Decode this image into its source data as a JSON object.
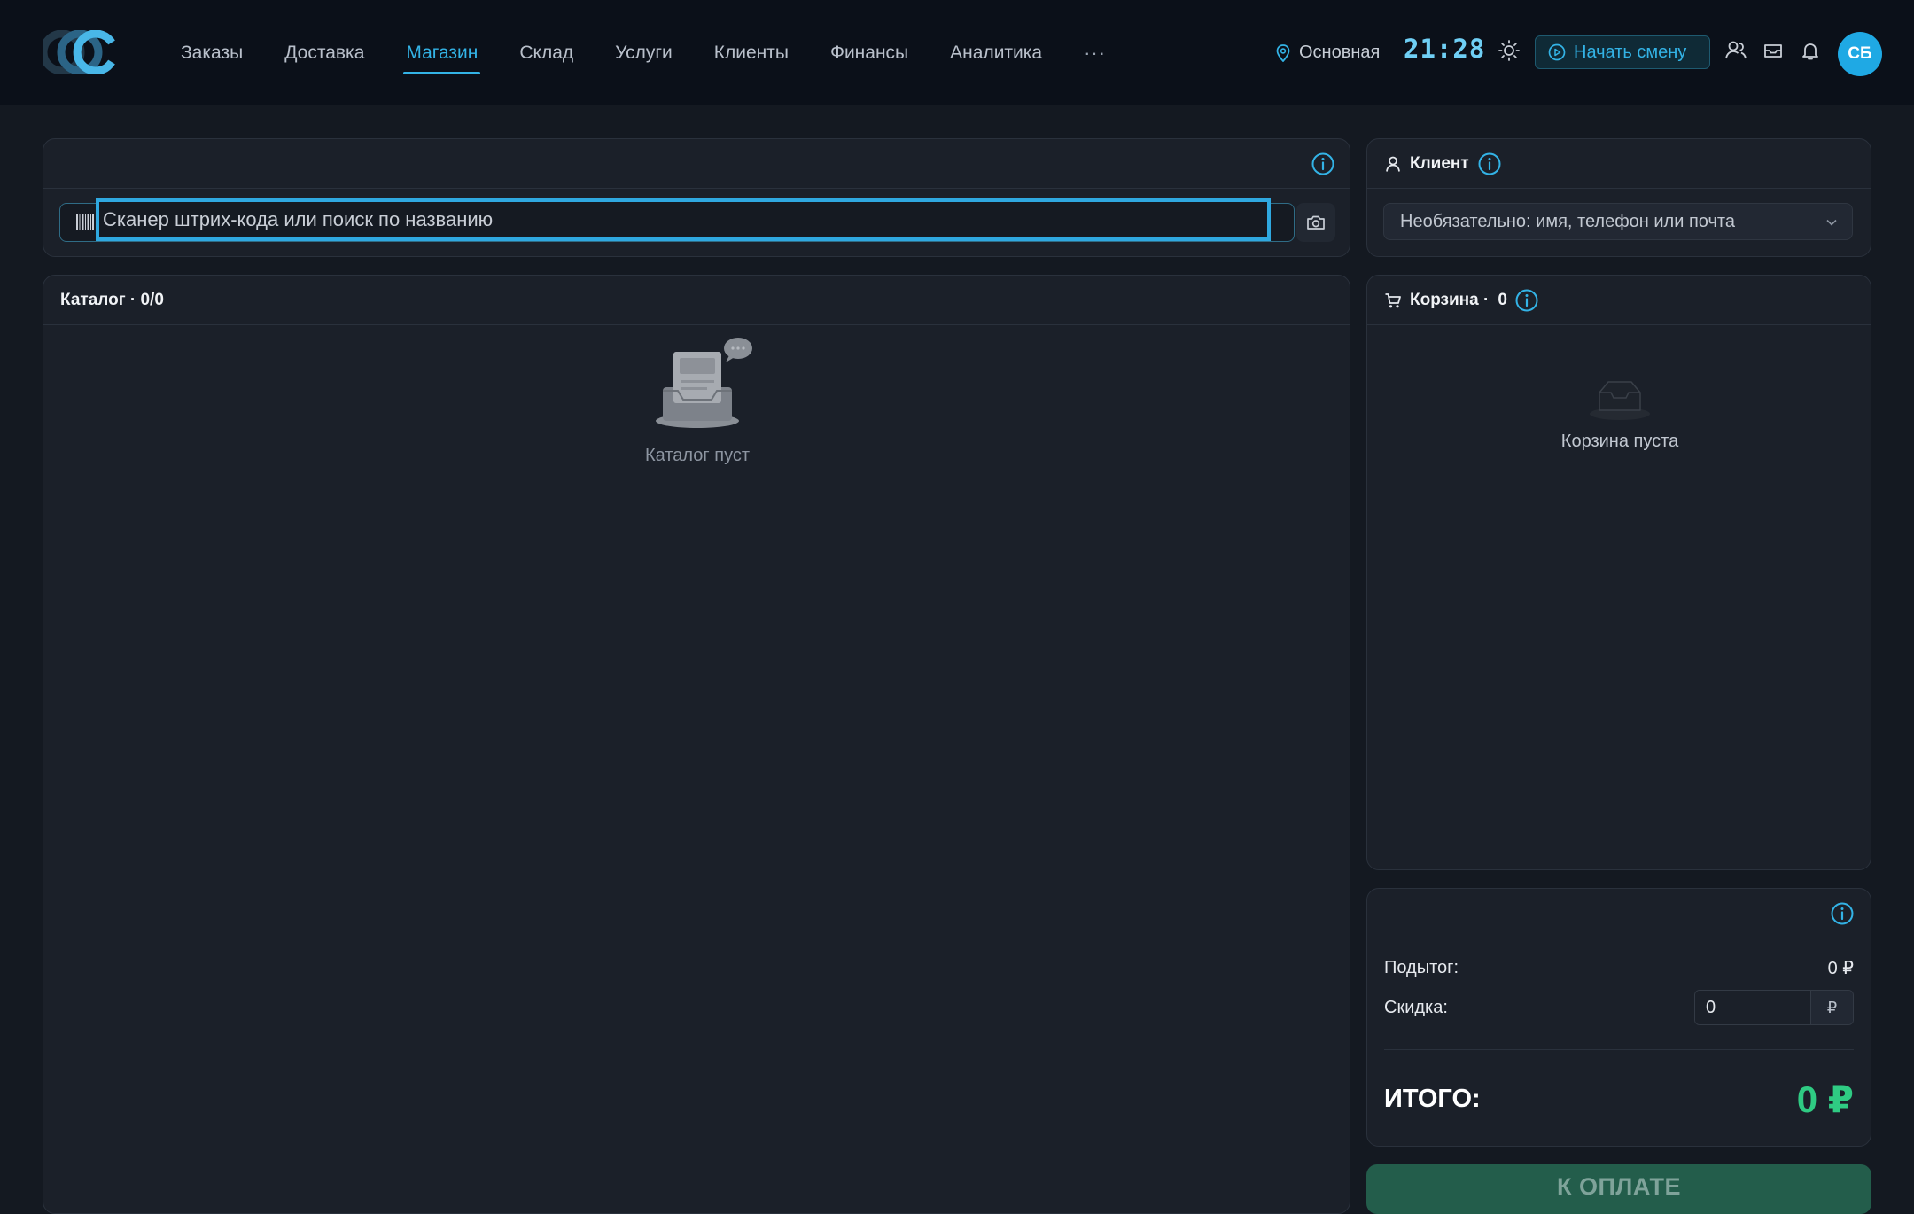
{
  "nav": {
    "items": [
      {
        "label": "Заказы",
        "active": false
      },
      {
        "label": "Доставка",
        "active": false
      },
      {
        "label": "Магазин",
        "active": true
      },
      {
        "label": "Склад",
        "active": false
      },
      {
        "label": "Услуги",
        "active": false
      },
      {
        "label": "Клиенты",
        "active": false
      },
      {
        "label": "Финансы",
        "active": false
      },
      {
        "label": "Аналитика",
        "active": false
      }
    ],
    "more": "···"
  },
  "header": {
    "location": "Основная",
    "time": "21:28",
    "shift_button": "Начать смену",
    "avatar_initials": "СБ"
  },
  "search": {
    "placeholder": "Сканер штрих-кода или поиск по названию"
  },
  "catalog": {
    "title": "Каталог · 0/0",
    "empty_text": "Каталог пуст"
  },
  "client": {
    "title": "Клиент",
    "select_placeholder": "Необязательно: имя, телефон или почта"
  },
  "cart": {
    "title": "Корзина ·",
    "count": "0",
    "empty_text": "Корзина пуста"
  },
  "summary": {
    "subtotal_label": "Подытог:",
    "subtotal_value": "0 ₽",
    "discount_label": "Скидка:",
    "discount_value": "0",
    "discount_currency": "₽",
    "total_label": "ИТОГО:",
    "total_value": "0 ₽",
    "pay_button": "К ОПЛАТЕ"
  },
  "colors": {
    "accent": "#33b3e6",
    "success": "#2fcb83",
    "background": "#141921",
    "panel": "#1b2029"
  }
}
